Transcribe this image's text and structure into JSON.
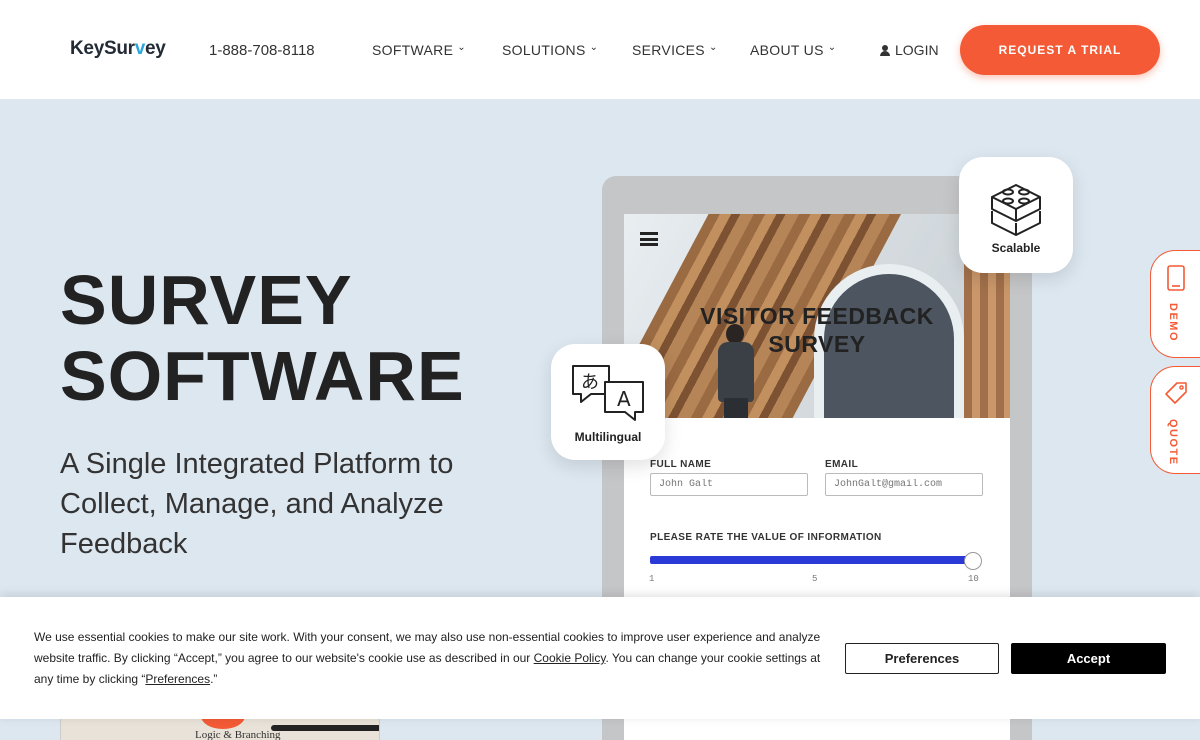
{
  "header": {
    "logo": {
      "pre": "KeySur",
      "v": "v",
      "post": "ey"
    },
    "phone": "1-888-708-8118",
    "nav": [
      {
        "label": "SOFTWARE"
      },
      {
        "label": "SOLUTIONS"
      },
      {
        "label": "SERVICES"
      },
      {
        "label": "ABOUT US"
      }
    ],
    "login": "LOGIN",
    "trial_button": "REQUEST A TRIAL"
  },
  "hero": {
    "title_line1": "SURVEY",
    "title_line2": "SOFTWARE",
    "subtitle": "A Single Integrated Platform to Collect, Manage, and Analyze Feedback"
  },
  "tablet": {
    "survey_title_line1": "VISITOR FEEDBACK",
    "survey_title_line2": "SURVEY",
    "full_name_label": "FULL NAME",
    "full_name_placeholder": "John Galt",
    "email_label": "EMAIL",
    "email_placeholder": "JohnGalt@gmail.com",
    "rate_label": "PLEASE RATE THE VALUE OF INFORMATION",
    "slider": {
      "min": "1",
      "mid": "5",
      "max": "10",
      "value": 10
    }
  },
  "cards": {
    "scalable": "Scalable",
    "multilingual": "Multilingual",
    "multilingual_glyph_a": "あ",
    "multilingual_glyph_b": "A"
  },
  "side_tabs": {
    "demo": "DEMO",
    "quote": "QUOTE"
  },
  "peek": {
    "text": "Logic & Branching"
  },
  "cookie": {
    "text_before": "We use essential cookies to make our site work. With your consent, we may also use non-essential cookies to improve user experience and analyze website traffic. By clicking “Accept,” you agree to our website's cookie use as described in our ",
    "policy_link": "Cookie Policy",
    "text_middle": ". You can change your cookie settings at any time by clicking “",
    "preferences_link": "Preferences",
    "text_end": ".”",
    "preferences_button": "Preferences",
    "accept_button": "Accept"
  },
  "colors": {
    "accent": "#f35a35",
    "hero_bg": "#dde7f0",
    "slider": "#2b3ad6"
  }
}
